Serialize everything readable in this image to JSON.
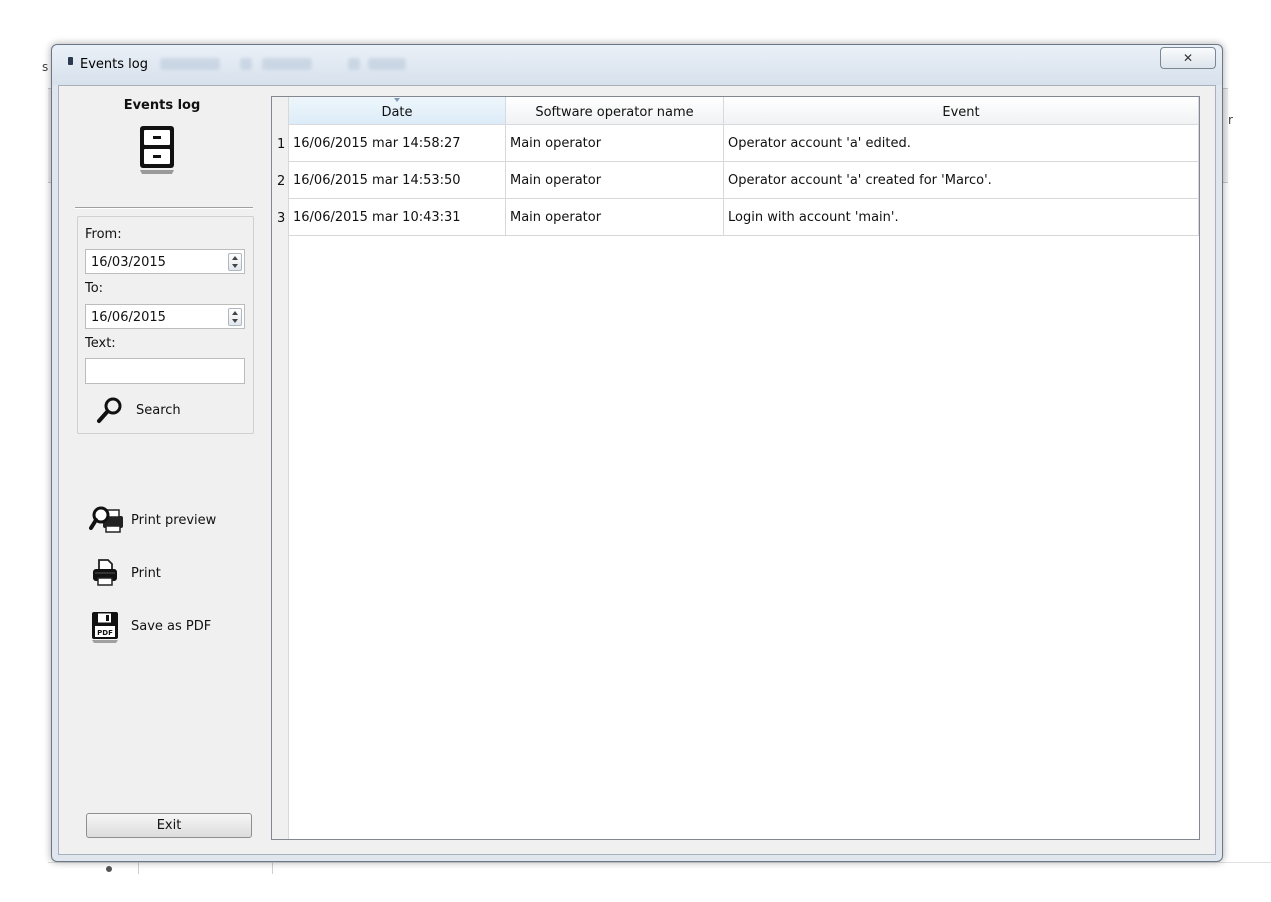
{
  "window": {
    "title": "Events log",
    "close_glyph": "✕"
  },
  "background": {
    "left_char": "s",
    "right_char": "r"
  },
  "sidebar": {
    "heading": "Events log",
    "from_label": "From:",
    "from_value": "16/03/2015",
    "to_label": "To:",
    "to_value": "16/06/2015",
    "text_label": "Text:",
    "text_value": "",
    "search_label": "Search",
    "print_preview_label": "Print preview",
    "print_label": "Print",
    "save_pdf_label": "Save as PDF",
    "exit_label": "Exit",
    "pdf_badge": "PDF"
  },
  "table": {
    "headers": [
      "Date",
      "Software operator name",
      "Event"
    ],
    "sorted_column": "Date",
    "rows": [
      {
        "num": "1",
        "date": "16/06/2015 mar 14:58:27",
        "operator": "Main operator",
        "event": "Operator account 'a' edited."
      },
      {
        "num": "2",
        "date": "16/06/2015 mar 14:53:50",
        "operator": "Main operator",
        "event": "Operator account 'a' created for 'Marco'."
      },
      {
        "num": "3",
        "date": "16/06/2015 mar 10:43:31",
        "operator": "Main operator",
        "event": "Login with account 'main'."
      }
    ]
  }
}
